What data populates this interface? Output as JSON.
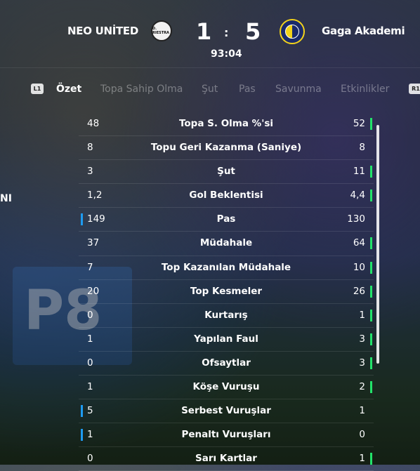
{
  "match": {
    "home_team": "NEO UNİTED",
    "away_team": "Gaga Akademi",
    "home_score": "1",
    "separator": ":",
    "away_score": "5",
    "clock": "93:04",
    "home_badge_text": "D. RIESTRA",
    "home_badge_letters": "A · C"
  },
  "tabs": {
    "left_trigger": "L1",
    "right_trigger": "R1",
    "items": [
      "Özet",
      "Topa Sahip Olma",
      "Şut",
      "Pas",
      "Savunma",
      "Etkinlikler"
    ],
    "active": "Özet"
  },
  "side_text": "NI",
  "background_text": "P8",
  "colors": {
    "home_highlight": "#1e9bf0",
    "away_highlight": "#22e36a"
  },
  "stats": [
    {
      "label": "Topa S. Olma %'si",
      "home": "48",
      "away": "52",
      "leader": "away"
    },
    {
      "label": "Topu Geri Kazanma (Saniye)",
      "home": "8",
      "away": "8",
      "leader": "none"
    },
    {
      "label": "Şut",
      "home": "3",
      "away": "11",
      "leader": "away"
    },
    {
      "label": "Gol Beklentisi",
      "home": "1,2",
      "away": "4,4",
      "leader": "away"
    },
    {
      "label": "Pas",
      "home": "149",
      "away": "130",
      "leader": "home"
    },
    {
      "label": "Müdahale",
      "home": "37",
      "away": "64",
      "leader": "away"
    },
    {
      "label": "Top Kazanılan Müdahale",
      "home": "7",
      "away": "10",
      "leader": "away"
    },
    {
      "label": "Top Kesmeler",
      "home": "20",
      "away": "26",
      "leader": "away"
    },
    {
      "label": "Kurtarış",
      "home": "0",
      "away": "1",
      "leader": "away"
    },
    {
      "label": "Yapılan Faul",
      "home": "1",
      "away": "3",
      "leader": "away"
    },
    {
      "label": "Ofsaytlar",
      "home": "0",
      "away": "3",
      "leader": "away"
    },
    {
      "label": "Köşe Vuruşu",
      "home": "1",
      "away": "2",
      "leader": "away"
    },
    {
      "label": "Serbest Vuruşlar",
      "home": "5",
      "away": "1",
      "leader": "home"
    },
    {
      "label": "Penaltı Vuruşları",
      "home": "1",
      "away": "0",
      "leader": "home"
    },
    {
      "label": "Sarı Kartlar",
      "home": "0",
      "away": "1",
      "leader": "away"
    }
  ]
}
